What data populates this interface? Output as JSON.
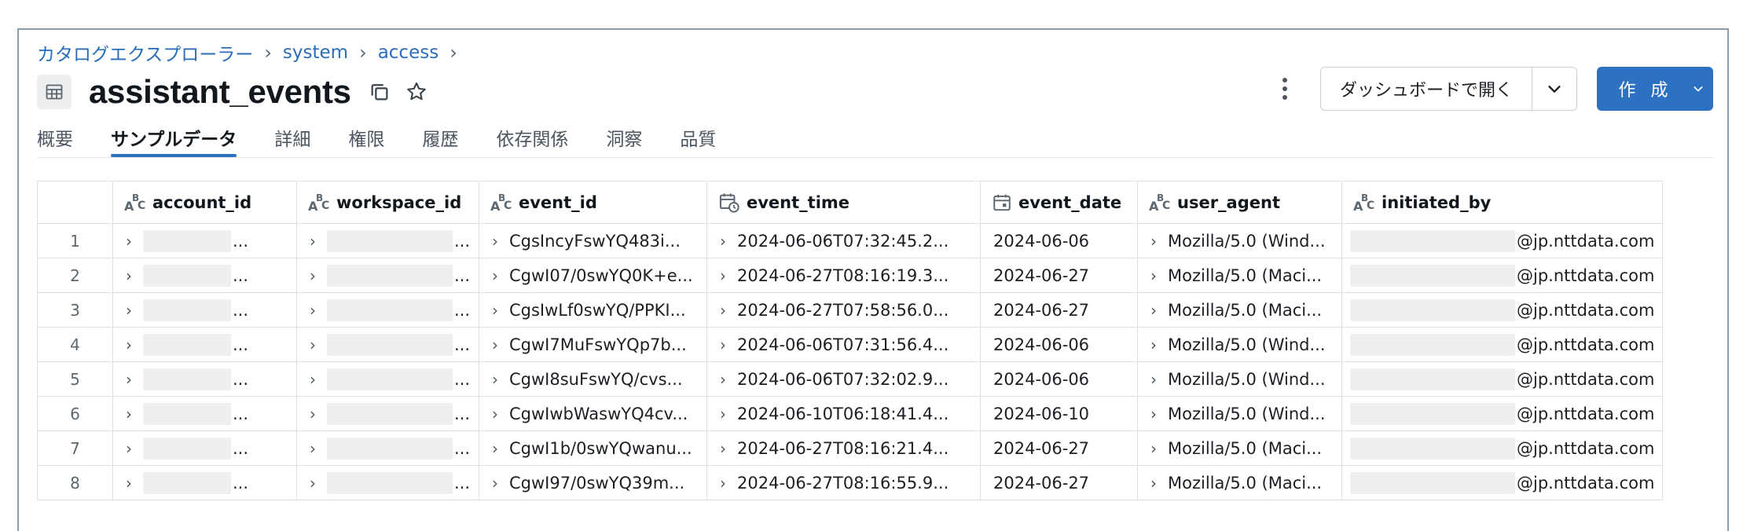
{
  "breadcrumb": {
    "items": [
      "カタログエクスプローラー",
      "system",
      "access"
    ],
    "separator": "›"
  },
  "title": "assistant_events",
  "actions": {
    "more": "more-options",
    "open_dashboard": "ダッシュボードで開く",
    "create": "作 成"
  },
  "tabs": [
    "概要",
    "サンプルデータ",
    "詳細",
    "権限",
    "履歴",
    "依存関係",
    "洞察",
    "品質"
  ],
  "active_tab": "サンプルデータ",
  "colors": {
    "accent": "#2d72c2",
    "link": "#2a6ebb",
    "redaction": "#eeeff1"
  },
  "columns": [
    {
      "name": "account_id",
      "type": "string"
    },
    {
      "name": "workspace_id",
      "type": "string"
    },
    {
      "name": "event_id",
      "type": "string"
    },
    {
      "name": "event_time",
      "type": "timestamp"
    },
    {
      "name": "event_date",
      "type": "date"
    },
    {
      "name": "user_agent",
      "type": "string"
    },
    {
      "name": "initiated_by",
      "type": "string"
    }
  ],
  "rows": [
    {
      "n": "1",
      "account_id": "...",
      "workspace_id": "...",
      "event_id": "CgsIncyFswYQ483i...",
      "event_time": "2024-06-06T07:32:45.2...",
      "event_date": "2024-06-06",
      "user_agent": "Mozilla/5.0 (Wind...",
      "initiated_by": "@jp.nttdata.com"
    },
    {
      "n": "2",
      "account_id": "...",
      "workspace_id": "...",
      "event_id": "CgwI07/0swYQ0K+e...",
      "event_time": "2024-06-27T08:16:19.3...",
      "event_date": "2024-06-27",
      "user_agent": "Mozilla/5.0 (Maci...",
      "initiated_by": "@jp.nttdata.com"
    },
    {
      "n": "3",
      "account_id": "...",
      "workspace_id": "...",
      "event_id": "CgsIwLf0swYQ/PPKI...",
      "event_time": "2024-06-27T07:58:56.0...",
      "event_date": "2024-06-27",
      "user_agent": "Mozilla/5.0 (Maci...",
      "initiated_by": "@jp.nttdata.com"
    },
    {
      "n": "4",
      "account_id": "...",
      "workspace_id": "...",
      "event_id": "CgwI7MuFswYQp7b...",
      "event_time": "2024-06-06T07:31:56.4...",
      "event_date": "2024-06-06",
      "user_agent": "Mozilla/5.0 (Wind...",
      "initiated_by": "@jp.nttdata.com"
    },
    {
      "n": "5",
      "account_id": "...",
      "workspace_id": "...",
      "event_id": "CgwI8suFswYQ/cvs...",
      "event_time": "2024-06-06T07:32:02.9...",
      "event_date": "2024-06-06",
      "user_agent": "Mozilla/5.0 (Wind...",
      "initiated_by": "@jp.nttdata.com"
    },
    {
      "n": "6",
      "account_id": "...",
      "workspace_id": "...",
      "event_id": "CgwIwbWaswYQ4cv...",
      "event_time": "2024-06-10T06:18:41.4...",
      "event_date": "2024-06-10",
      "user_agent": "Mozilla/5.0 (Wind...",
      "initiated_by": "@jp.nttdata.com"
    },
    {
      "n": "7",
      "account_id": "...",
      "workspace_id": "...",
      "event_id": "CgwI1b/0swYQwanu...",
      "event_time": "2024-06-27T08:16:21.4...",
      "event_date": "2024-06-27",
      "user_agent": "Mozilla/5.0 (Maci...",
      "initiated_by": "@jp.nttdata.com"
    },
    {
      "n": "8",
      "account_id": "...",
      "workspace_id": "...",
      "event_id": "CgwI97/0swYQ39m...",
      "event_time": "2024-06-27T08:16:55.9...",
      "event_date": "2024-06-27",
      "user_agent": "Mozilla/5.0 (Maci...",
      "initiated_by": "@jp.nttdata.com"
    }
  ]
}
